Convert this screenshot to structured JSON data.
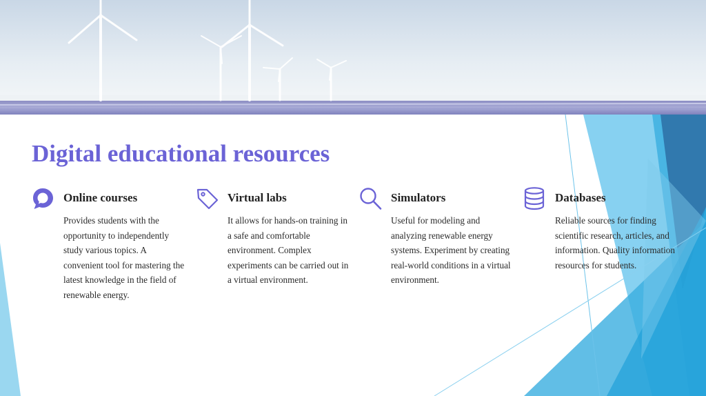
{
  "slide": {
    "title": "Digital educational resources",
    "accent_color": "#6b63d6",
    "colors": {
      "blue_light": "#8fd3ee",
      "blue_mid": "#3aaee0",
      "blue_dark": "#1f6aa0"
    }
  },
  "hero": {
    "image": "wind-turbines-photo"
  },
  "cards": [
    {
      "icon": "chat-bubble-icon",
      "heading": "Online courses",
      "body": "Provides students with the opportunity to independently study various topics. A convenient tool for mastering the latest knowledge in the field of renewable energy."
    },
    {
      "icon": "tag-icon",
      "heading": "Virtual labs",
      "body": "It allows for hands-on training in a safe and comfortable environment. Complex experiments can be carried out in a virtual environment."
    },
    {
      "icon": "search-icon",
      "heading": "Simulators",
      "body": "Useful for modeling and analyzing renewable energy systems. Experiment by creating real-world conditions in a virtual environment."
    },
    {
      "icon": "database-icon",
      "heading": "Databases",
      "body": "Reliable sources for finding scientific research, articles, and information. Quality information resources for students."
    }
  ]
}
